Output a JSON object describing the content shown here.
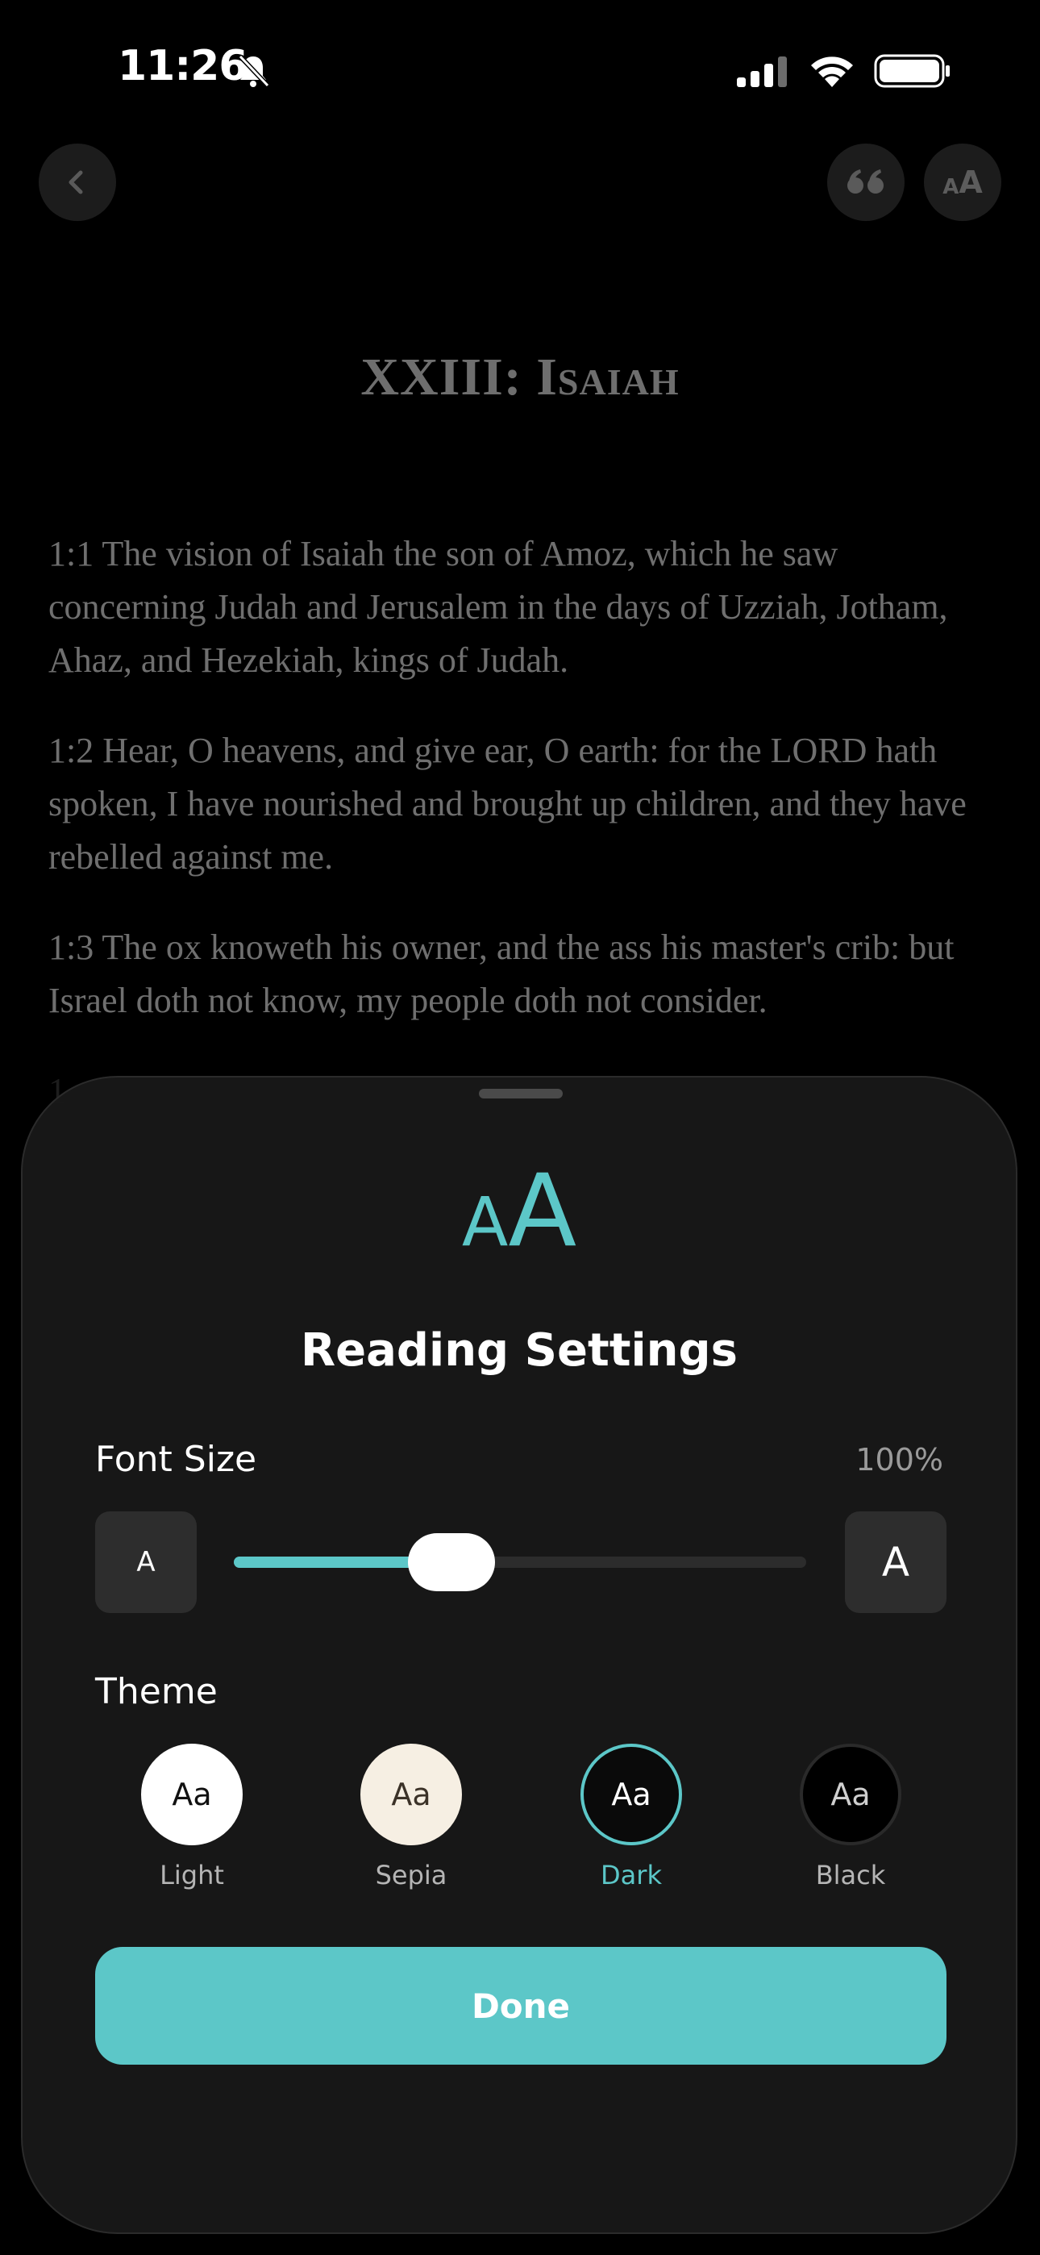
{
  "status_bar": {
    "time": "11:26",
    "silent_icon": "bell-slash-icon",
    "signal_icon": "cellular-signal-icon",
    "wifi_icon": "wifi-icon",
    "battery_icon": "battery-icon"
  },
  "toolbar": {
    "back_icon": "chevron-left-icon",
    "quote_icon": "quote-icon",
    "text_size_small": "A",
    "text_size_big": "A"
  },
  "reader": {
    "chapter_title": "XXIII: Isaiah",
    "verses": [
      "1:1 The vision of Isaiah the son of Amoz, which he saw concerning Judah and Jerusalem in the days of Uzziah, Jotham, Ahaz, and Hezekiah, kings of Judah.",
      "1:2 Hear, O heavens, and give ear, O earth: for the LORD hath spoken, I have nourished and brought up children, and they have rebelled against me.",
      "1:3 The ox knoweth his owner, and the ass his master's crib: but Israel doth not know, my people doth not consider."
    ],
    "faded_verse_start": "1"
  },
  "reading_settings": {
    "icon_small": "A",
    "icon_big": "A",
    "title": "Reading Settings",
    "font_size_label": "Font Size",
    "font_size_value": "100%",
    "decrease_label": "A",
    "increase_label": "A",
    "slider_level": 0.38,
    "theme_label": "Theme",
    "themes": [
      {
        "name": "Light",
        "sample": "Aa",
        "bg": "#ffffff",
        "fg": "#111111",
        "border": "#ffffff"
      },
      {
        "name": "Sepia",
        "sample": "Aa",
        "bg": "#f6efe3",
        "fg": "#3b3228",
        "border": "#f6efe3"
      },
      {
        "name": "Dark",
        "sample": "Aa",
        "bg": "#0a0a0a",
        "fg": "#ffffff",
        "border": "#5cc7c8"
      },
      {
        "name": "Black",
        "sample": "Aa",
        "bg": "#000000",
        "fg": "#cfcfcf",
        "border": "#2a2a2a"
      }
    ],
    "selected_theme": "Dark",
    "done_label": "Done",
    "accent_color": "#5cc7c8"
  }
}
